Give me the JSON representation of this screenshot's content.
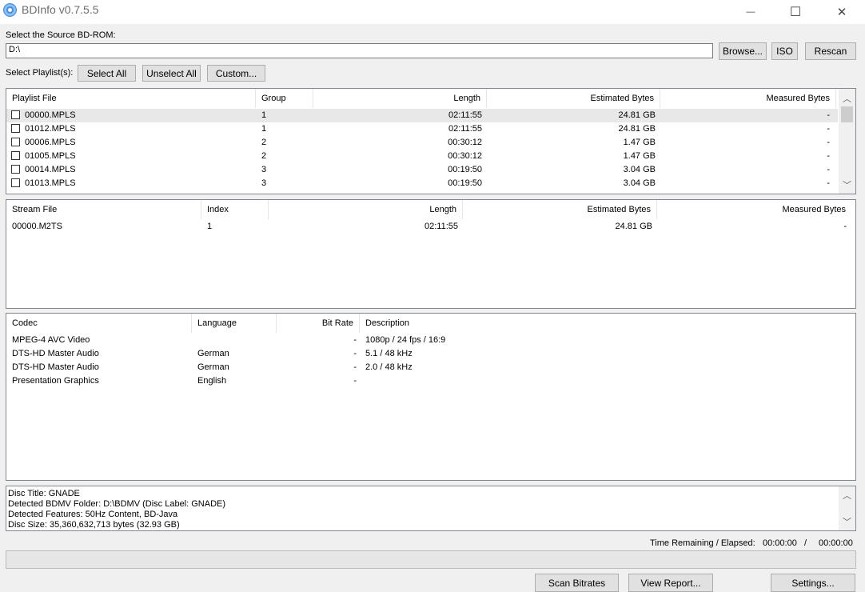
{
  "window": {
    "title": "BDInfo v0.7.5.5",
    "controls": {
      "minimize": "—",
      "maximize": "☐",
      "close": "✕"
    }
  },
  "source": {
    "label": "Select the Source BD-ROM:",
    "value": "D:\\",
    "browse": "Browse...",
    "iso": "ISO",
    "rescan": "Rescan"
  },
  "playlist_select": {
    "label": "Select Playlist(s):",
    "select_all": "Select All",
    "unselect_all": "Unselect All",
    "custom": "Custom..."
  },
  "playlists": {
    "headers": [
      "Playlist File",
      "Group",
      "Length",
      "Estimated Bytes",
      "Measured Bytes"
    ],
    "rows": [
      {
        "file": "00000.MPLS",
        "group": "1",
        "length": "02:11:55",
        "est": "24.81 GB",
        "meas": "-"
      },
      {
        "file": "01012.MPLS",
        "group": "1",
        "length": "02:11:55",
        "est": "24.81 GB",
        "meas": "-"
      },
      {
        "file": "00006.MPLS",
        "group": "2",
        "length": "00:30:12",
        "est": "1.47 GB",
        "meas": "-"
      },
      {
        "file": "01005.MPLS",
        "group": "2",
        "length": "00:30:12",
        "est": "1.47 GB",
        "meas": "-"
      },
      {
        "file": "00014.MPLS",
        "group": "3",
        "length": "00:19:50",
        "est": "3.04 GB",
        "meas": "-"
      },
      {
        "file": "01013.MPLS",
        "group": "3",
        "length": "00:19:50",
        "est": "3.04 GB",
        "meas": "-"
      }
    ]
  },
  "streams": {
    "headers": [
      "Stream File",
      "Index",
      "Length",
      "Estimated Bytes",
      "Measured Bytes"
    ],
    "rows": [
      {
        "file": "00000.M2TS",
        "index": "1",
        "length": "02:11:55",
        "est": "24.81 GB",
        "meas": "-"
      }
    ]
  },
  "codecs": {
    "headers": [
      "Codec",
      "Language",
      "Bit Rate",
      "Description"
    ],
    "rows": [
      {
        "codec": "MPEG-4 AVC Video",
        "language": "",
        "bitrate": "-",
        "desc": "1080p / 24 fps / 16:9"
      },
      {
        "codec": "DTS-HD Master Audio",
        "language": "German",
        "bitrate": "-",
        "desc": "5.1 / 48 kHz"
      },
      {
        "codec": "DTS-HD Master Audio",
        "language": "German",
        "bitrate": "-",
        "desc": "2.0 / 48 kHz"
      },
      {
        "codec": "Presentation Graphics",
        "language": "English",
        "bitrate": "-",
        "desc": ""
      }
    ]
  },
  "info": {
    "lines": [
      "Disc Title: GNADE",
      "Detected BDMV Folder: D:\\BDMV (Disc Label: GNADE)",
      "Detected Features: 50Hz Content, BD-Java",
      "Disc Size: 35,360,632,713 bytes (32.93 GB)"
    ]
  },
  "time": {
    "label": "Time Remaining / Elapsed:",
    "remaining": "00:00:00",
    "sep": "/",
    "elapsed": "00:00:00"
  },
  "progress": {
    "value": 0
  },
  "bottom": {
    "scan_bitrates": "Scan Bitrates",
    "view_report": "View Report...",
    "settings": "Settings..."
  }
}
